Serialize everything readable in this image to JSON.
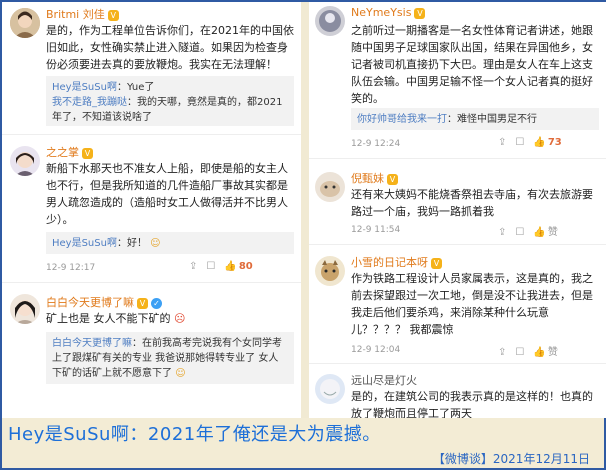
{
  "left": {
    "posts": [
      {
        "user": "Britmi 刘佳",
        "text": "是的，作为工程单位告诉你们，在2021年的中国依旧如此，女性确实禁止进入隧道。如果因为检查身份必须要进去真的要放鞭炮。我实在无法理解！",
        "replies": [
          {
            "who": "Hey是SuSu啊",
            "body": "：Yue了"
          },
          {
            "who": "我不走路_我蹦哒",
            "body": "：我的天哪，竟然是真的，都2021年了，不知道该说啥了"
          }
        ]
      },
      {
        "user": "之之掌",
        "text": "新船下水那天也不准女人上船，即使是船的女主人也不行，但是我所知道的几件造船厂事故其实都是男人疏忽造成的（造船时女工人做得活并不比男人少）。",
        "replies": [
          {
            "who": "Hey是SuSu啊",
            "body": "：好！"
          }
        ],
        "date": "12-9 12:17",
        "likes": "80"
      },
      {
        "user": "白白今天更博了嘛",
        "text": "矿上也是 女人不能下矿的",
        "replies": [
          {
            "who": "白白今天更博了嘛",
            "body": "：在前我高考完说我有个女同学考上了跟煤矿有关的专业 我爸说那她得转专业了 女人下矿的话矿上就不愿意下了"
          }
        ]
      }
    ]
  },
  "right": {
    "posts": [
      {
        "user": "NeYmeYsis",
        "text": "之前听过一期播客是一名女性体育记者讲述，她跟随中国男子足球国家队出国，结果在异国他乡，女记者被司机直接扔下大巴。理由是女人在车上这支队伍会输。中国男足输不怪一个女人记者真的挺好笑的。",
        "replies": [
          {
            "who": "你好帅哥给我来一打",
            "body": "：难怪中国男足不行"
          }
        ],
        "date": "12-9 12:24",
        "likes": "73"
      },
      {
        "user": "倪甄妹",
        "text": "还有来大姨妈不能烧香祭祖去寺庙，有次去旅游要路过一个庙，我妈一路抓着我",
        "date": "12-9 11:54",
        "likes": "赞"
      },
      {
        "user": "小雪的日记本呀",
        "text": "作为铁路工程设计人员家属表示，这是真的，我之前去探望跟过一次工地，倒是没不让我进去，但是我走后他们要杀鸡，来消除某种什么玩意儿？？？？ 我都震惊",
        "date": "12-9 12:04",
        "likes": "赞"
      },
      {
        "user": "远山尽是灯火",
        "text": "是的，在建筑公司的我表示真的是这样的！也真的放了鞭炮而且停工了两天"
      }
    ]
  },
  "caption": "Hey是SuSu啊：2021年了俺还是大为震撼。",
  "footer": "【微博谈】2021年12月11日",
  "colors": {
    "caption": "#1d6fd8",
    "frame_border": "#2f5aa3",
    "username": "#e07a1b",
    "reply_user": "#4f7ec2"
  }
}
